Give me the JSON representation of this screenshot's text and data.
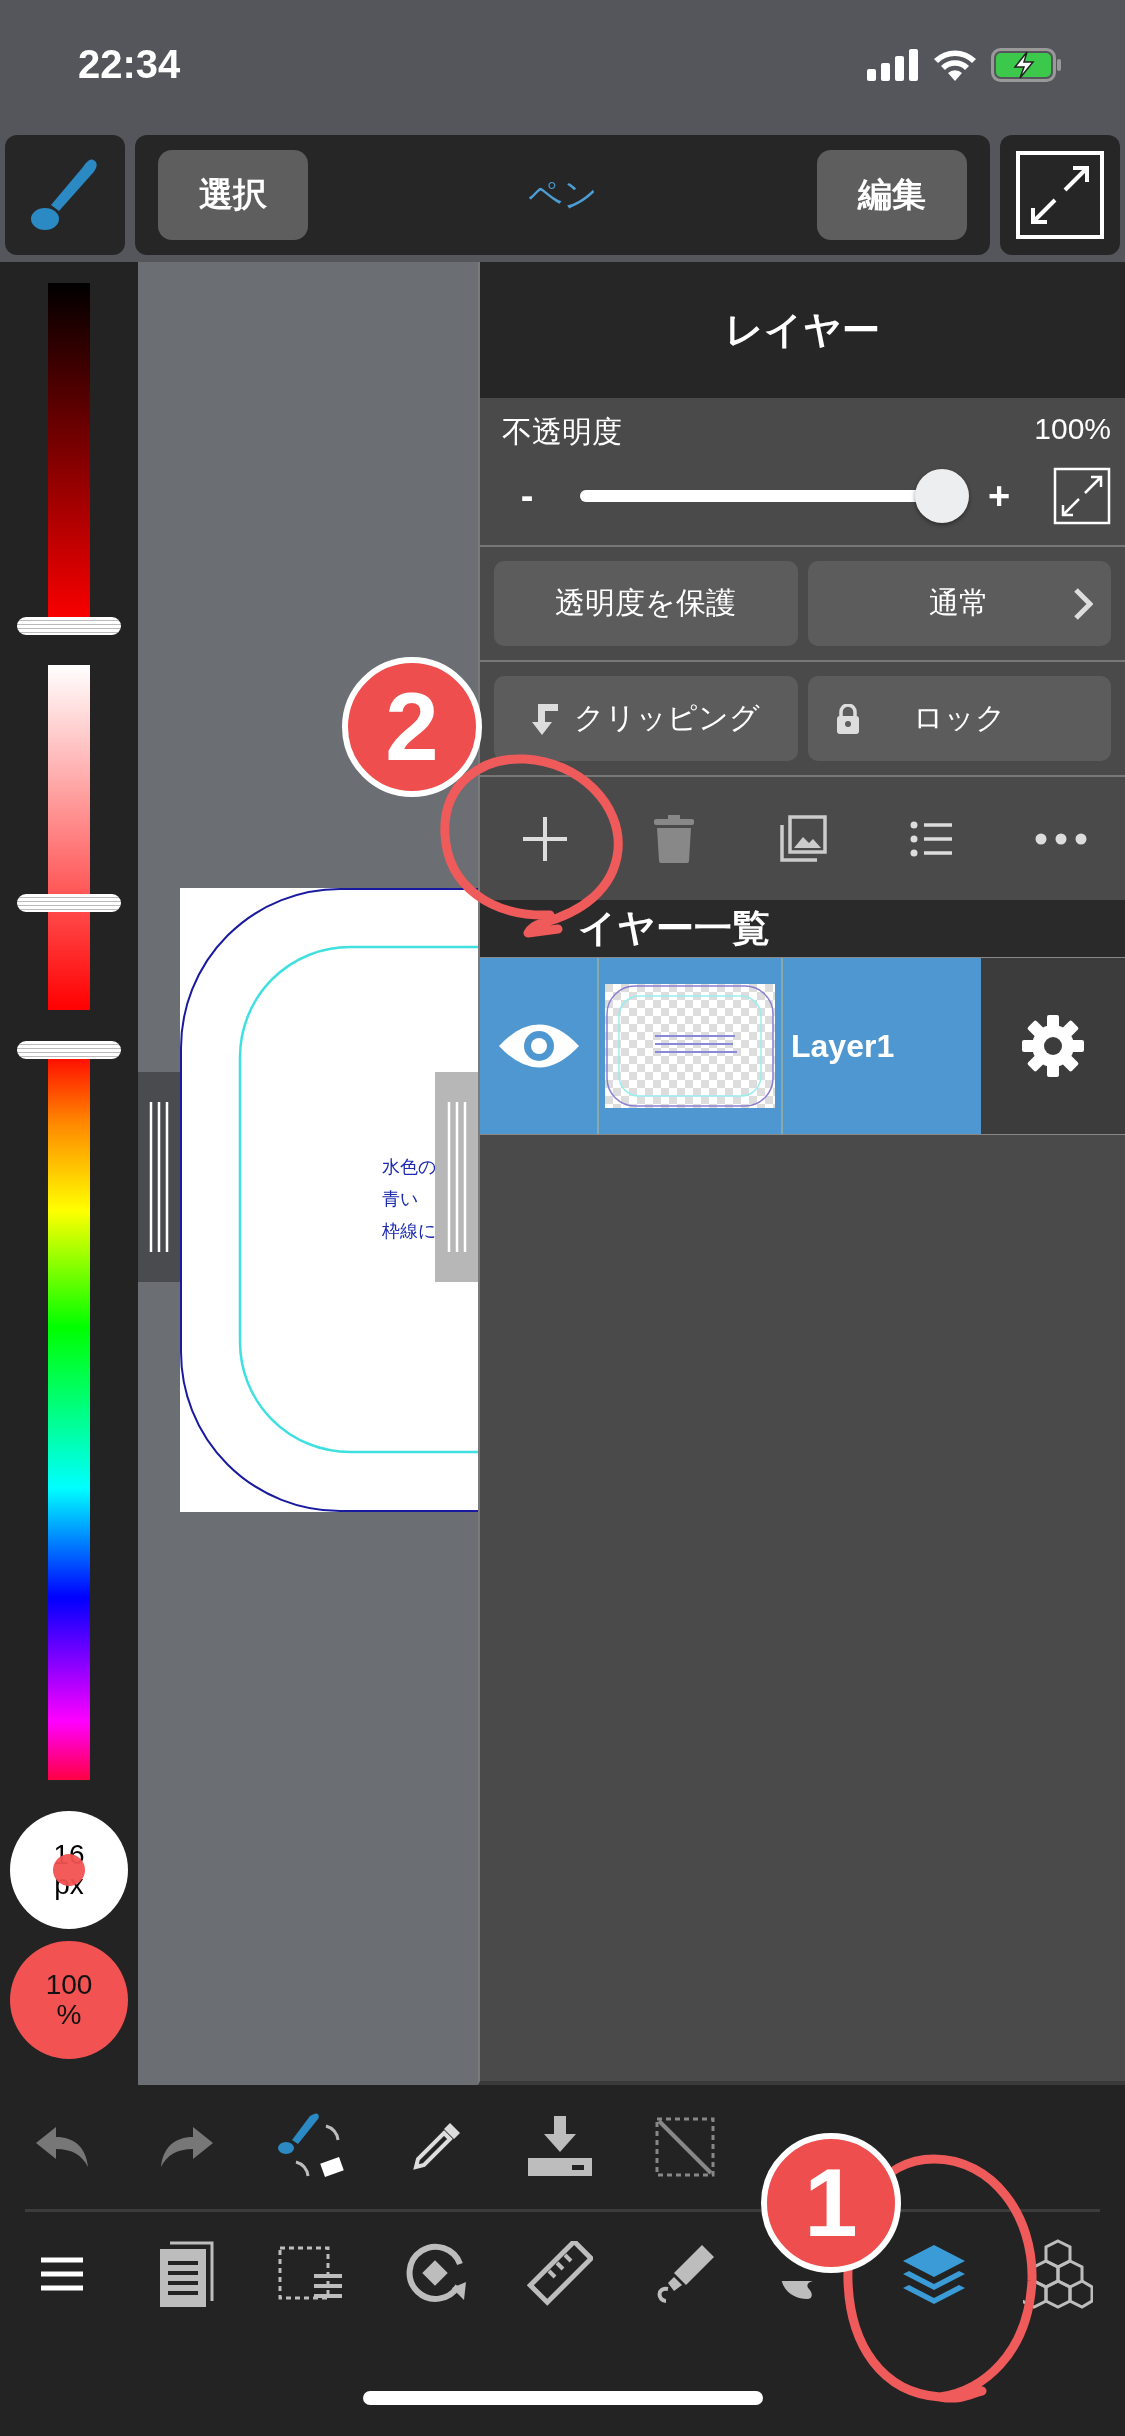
{
  "status_bar": {
    "time": "22:34"
  },
  "toolbar": {
    "left_button": "選択",
    "title": "ペン",
    "right_button": "編集"
  },
  "color_sliders": [
    {
      "kind": "brightness"
    },
    {
      "kind": "saturation"
    },
    {
      "kind": "hue"
    }
  ],
  "brush_size": {
    "value": "16",
    "unit": "px"
  },
  "brush_opacity": {
    "value": "100",
    "unit": "%"
  },
  "canvas": {
    "text_lines": [
      "水色の",
      "青い",
      "枠線に"
    ]
  },
  "layer_panel": {
    "title": "レイヤー",
    "opacity_label": "不透明度",
    "opacity_value": "100%",
    "opacity_slider": {
      "level": 1
    },
    "minus": "-",
    "plus": "+",
    "protect_alpha": "透明度を保護",
    "blend_mode": "通常",
    "clipping": "クリッピング",
    "lock": "ロック",
    "list_title": "イヤー一覧",
    "layers": [
      {
        "name": "Layer1",
        "visible": true,
        "selected": true
      }
    ]
  },
  "bottom_toolbar": {
    "row_2": [
      {
        "selected": false
      },
      {
        "selected": false
      },
      {
        "selected": false
      },
      {
        "selected": false
      },
      {
        "selected": false
      },
      {
        "selected": false
      },
      {
        "selected": false
      },
      {
        "selected": true
      },
      {
        "selected": false
      }
    ]
  },
  "annotations": [
    {
      "label": "2"
    },
    {
      "label": "1"
    }
  ]
}
